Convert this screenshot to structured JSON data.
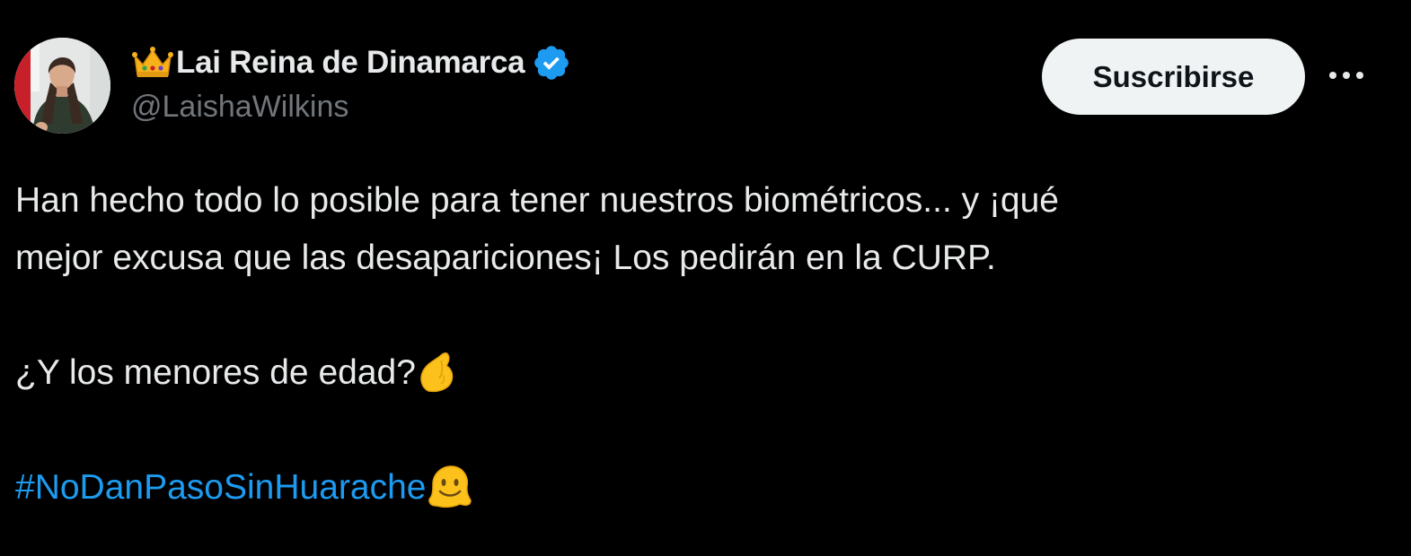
{
  "author": {
    "display_name": "Lai Reina de Dinamarca",
    "handle": "@LaishaWilkins",
    "name_prefix_emoji": "crown-icon",
    "verified_badge": "verified-icon",
    "verified_color": "#1d9bf0"
  },
  "actions": {
    "subscribe_label": "Suscribirse",
    "more_icon": "more-horizontal-icon"
  },
  "tweet": {
    "line1": "Han hecho todo lo posible para tener nuestros biométricos... y ¡qué",
    "line2": "mejor excusa que las desapariciones¡  Los pedirán en la CURP.",
    "question": "¿Y los menores de edad?",
    "question_emoji": "pinching-hand-icon",
    "hashtag": "#NoDanPasoSinHuarache",
    "hashtag_emoji": "melting-face-icon",
    "hashtag_color": "#1d9bf0"
  }
}
